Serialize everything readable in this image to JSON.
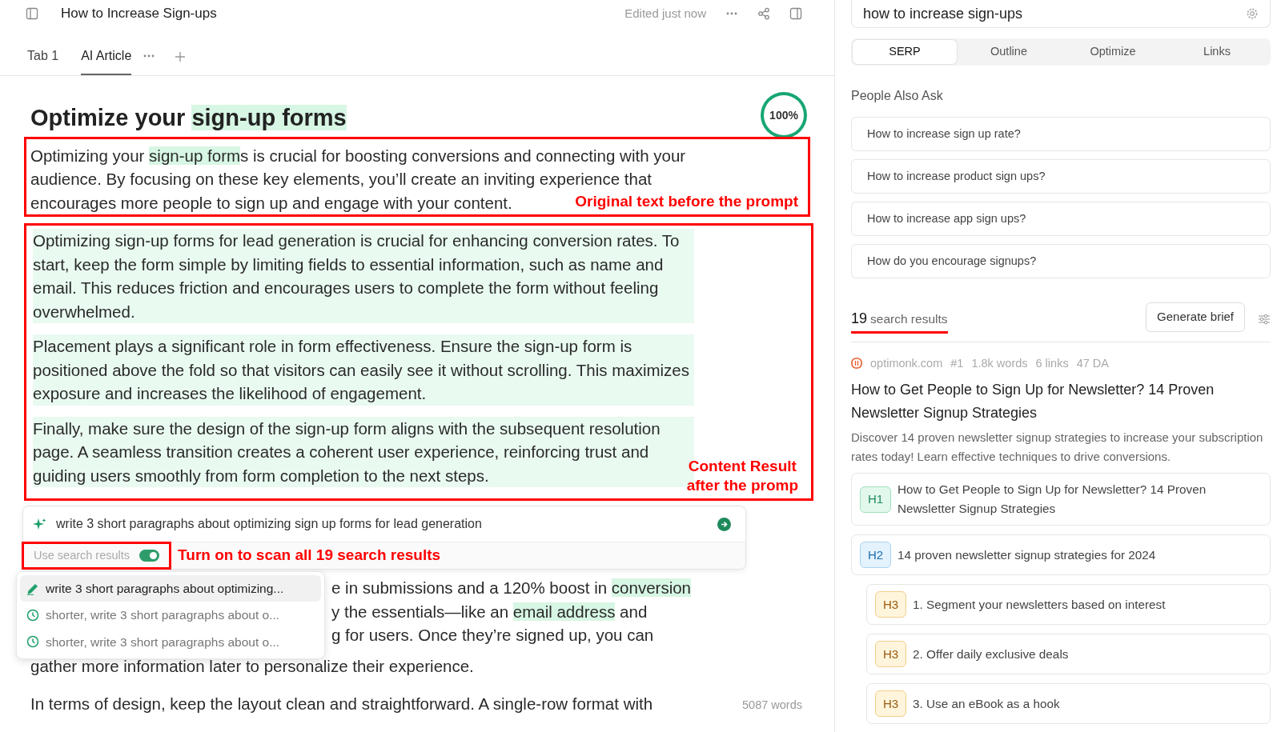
{
  "doc_header": {
    "title": "How to Increase Sign-ups",
    "status": "Edited just now"
  },
  "tabs": [
    {
      "label": "Tab 1",
      "selected": false
    },
    {
      "label": "AI Article",
      "selected": true
    }
  ],
  "heading": [
    {
      "text": "Optimize your ",
      "highlighted": false
    },
    {
      "text": "sign-up forms",
      "highlighted": true
    }
  ],
  "score": {
    "text": "100%",
    "level": 1
  },
  "original_paragraph": {
    "segments": [
      {
        "text": "Optimizing your ",
        "highlighted": false
      },
      {
        "text": "sign-up form",
        "highlighted": true
      },
      {
        "text": "s is crucial for boosting conversions and connecting with your audience. By focusing on these key elements, you’ll create an inviting experience that encourages more people to sign up and engage with your content.",
        "highlighted": false
      }
    ],
    "annotation": "Original text before the prompt"
  },
  "generated": {
    "paragraphs": [
      "Optimizing sign-up forms for lead generation is crucial for enhancing conversion rates. To start, keep the form simple by limiting fields to essential information, such as name and email. This reduces friction and encourages users to complete the form without feeling overwhelmed.",
      "Placement plays a significant role in form effectiveness. Ensure the sign-up form is positioned above the fold so that visitors can easily see it without scrolling. This maximizes exposure and increases the likelihood of engagement.",
      "Finally, make sure the design of the sign-up form aligns with the subsequent resolution page. A seamless transition creates a coherent user experience, reinforcing trust and guiding users smoothly from form completion to the next steps."
    ],
    "annotation_lines": [
      "Content Result",
      "after the promp"
    ]
  },
  "prompt": {
    "text": "write 3 short paragraphs about optimizing sign up forms for lead generation",
    "toggle_label": "Use search results",
    "toggle_on": true,
    "annotation": "Turn on to scan all 19 search results"
  },
  "history": [
    {
      "kind": "edit",
      "text": "write 3 short paragraphs about optimizing...",
      "selected": true
    },
    {
      "kind": "recent",
      "text": "shorter, write 3 short paragraphs about o...",
      "selected": false
    },
    {
      "kind": "recent",
      "text": "shorter, write 3 short paragraphs about o...",
      "selected": false
    }
  ],
  "covered_lines": [
    {
      "segments": [
        {
          "text": "e in submissions and a 120% boost in ",
          "highlighted": false
        },
        {
          "text": "conversion",
          "highlighted": true
        }
      ]
    },
    {
      "segments": [
        {
          "text": "y the essentials—like an ",
          "highlighted": false
        },
        {
          "text": "email address",
          "highlighted": true
        },
        {
          "text": " and",
          "highlighted": false
        }
      ]
    },
    {
      "segments": [
        {
          "text": "g for users. Once they’re signed up, you can",
          "highlighted": false
        }
      ]
    },
    {
      "segments": [
        {
          "text": "gather more information later to personalize their experience.",
          "highlighted": false
        }
      ]
    }
  ],
  "next_paragraph": "In terms of design, keep the layout clean and straightforward. A single-row format with",
  "word_count": "5087 words",
  "serp": {
    "query": "how to increase sign-ups",
    "tabs": [
      {
        "label": "SERP",
        "selected": true
      },
      {
        "label": "Outline",
        "selected": false
      },
      {
        "label": "Optimize",
        "selected": false
      },
      {
        "label": "Links",
        "selected": false
      }
    ],
    "paa_title": "People Also Ask",
    "questions": [
      "How to increase sign up rate?",
      "How to increase product sign ups?",
      "How to increase app sign ups?",
      "How do you encourage signups?"
    ],
    "results_count": "19",
    "results_label": "search results",
    "generate_button": "Generate brief",
    "result": {
      "site": "optimonk.com",
      "rank": "#1",
      "words": "1.8k words",
      "links": "6 links",
      "da": "47 DA",
      "title": "How to Get People to Sign Up for Newsletter? 14 Proven Newsletter Signup Strategies",
      "description": "Discover 14 proven newsletter signup strategies to increase your subscription rates today! Learn effective techniques to drive conversions.",
      "outline": [
        {
          "tag": "H1",
          "text": "How to Get People to Sign Up for Newsletter? 14 Proven Newsletter Signup Strategies"
        },
        {
          "tag": "H2",
          "text": "14 proven newsletter signup strategies for 2024",
          "children": [
            {
              "tag": "H3",
              "text": "1. Segment your newsletters based on interest"
            },
            {
              "tag": "H3",
              "text": "2. Offer daily exclusive deals"
            },
            {
              "tag": "H3",
              "text": "3. Use an eBook as a hook"
            }
          ]
        }
      ]
    }
  }
}
